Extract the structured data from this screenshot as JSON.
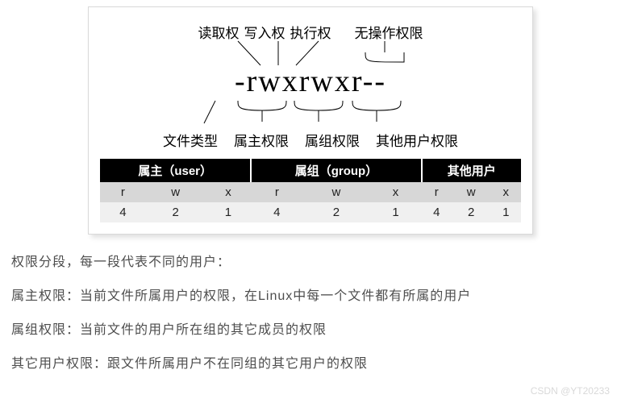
{
  "diagram": {
    "top_labels": [
      "读取权",
      "写入权",
      "执行权",
      "无操作权限"
    ],
    "permission_string": "-rwxrwxr--",
    "bottom_labels": [
      "文件类型",
      "属主权限",
      "属组权限",
      "其他用户权限"
    ]
  },
  "table": {
    "groups": [
      {
        "name": "属主（user）"
      },
      {
        "name": "属组（group）"
      },
      {
        "name": "其他用户"
      }
    ],
    "perm_letters": [
      "r",
      "w",
      "x",
      "r",
      "w",
      "x",
      "r",
      "w",
      "x"
    ],
    "perm_numbers": [
      "4",
      "2",
      "1",
      "4",
      "2",
      "1",
      "4",
      "2",
      "1"
    ]
  },
  "paragraphs": [
    "权限分段，每一段代表不同的用户：",
    "属主权限：当前文件所属用户的权限，在Linux中每一个文件都有所属的用户",
    "属组权限：当前文件的用户所在组的其它成员的权限",
    "其它用户权限：跟文件所属用户不在同组的其它用户的权限"
  ],
  "watermark": "CSDN @YT20233"
}
